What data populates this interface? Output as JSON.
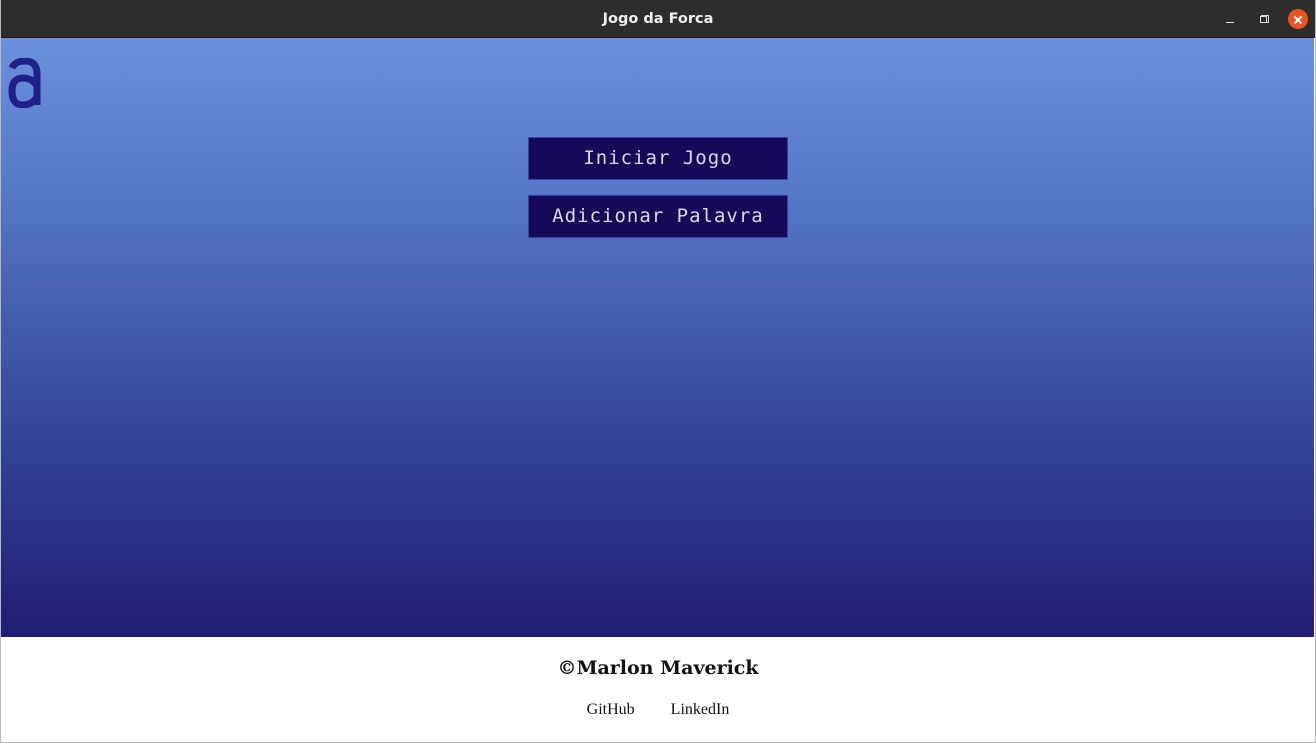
{
  "window": {
    "title": "Jogo da Forca",
    "controls": [
      "minimize-icon",
      "maximize-icon",
      "close-icon"
    ],
    "close_color": "#e95420"
  },
  "main": {
    "logo_icon": "alura-a-logo-icon",
    "buttons": {
      "start_label": "Iniciar Jogo",
      "add_word_label": "Adicionar Palavra"
    },
    "colors": {
      "gradient_top": "#6a90dc",
      "gradient_bottom": "#231c72",
      "button_bg": "#160a58",
      "button_text": "#d9d9e6",
      "logo": "#20208a"
    }
  },
  "footer": {
    "copyright": "©Marlon Maverick",
    "links": {
      "github": "GitHub",
      "linkedin": "LinkedIn"
    }
  }
}
